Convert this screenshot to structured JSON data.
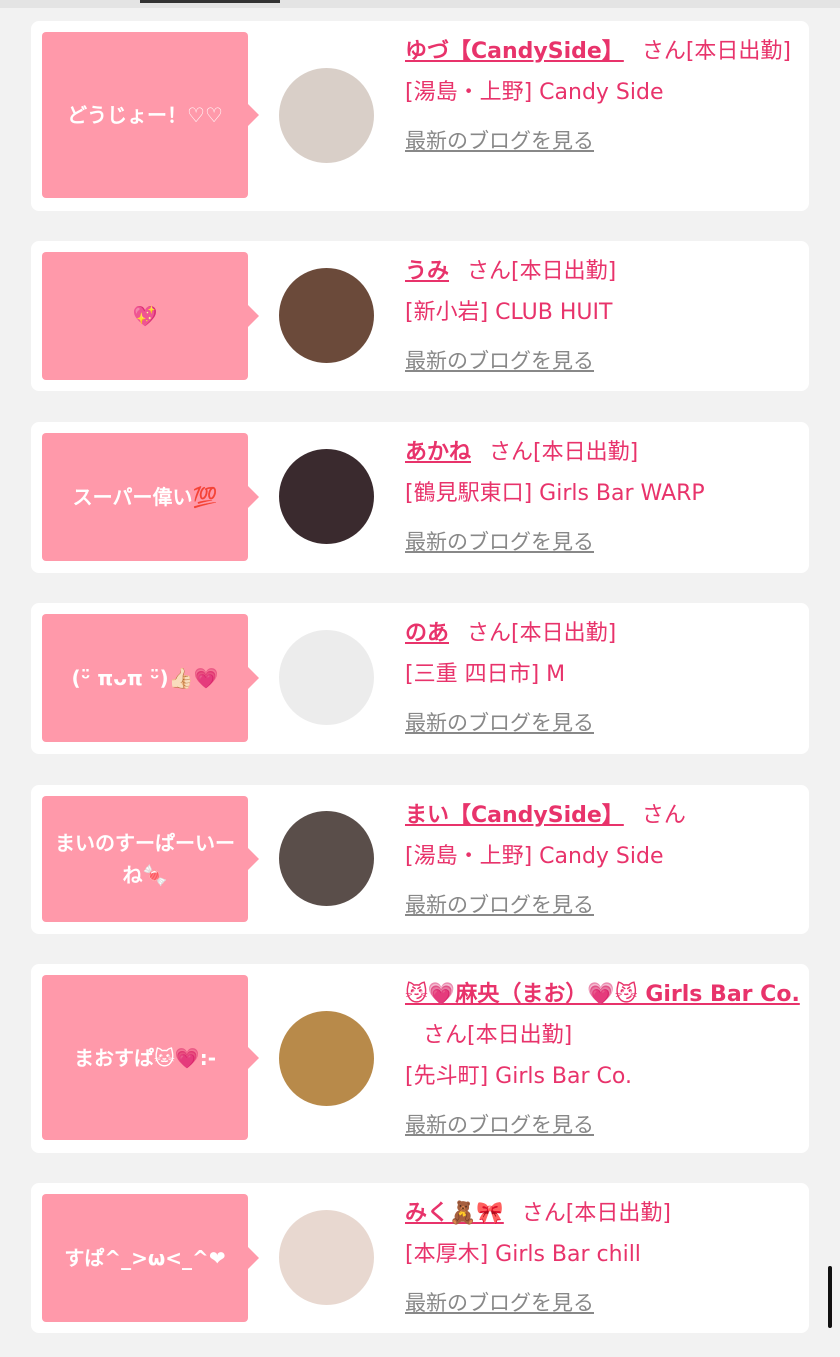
{
  "cards": [
    {
      "bubble": "どうじょー！♡♡",
      "name": "ゆづ【CandySide】",
      "suffix": "さん[本日出勤]",
      "shop": "[湯島・上野] Candy Side",
      "blog": "最新のブログを見る",
      "avatar_color": "#d9cfc8"
    },
    {
      "bubble": "💖",
      "name": "うみ",
      "suffix": "さん[本日出勤]",
      "shop": "[新小岩] CLUB HUIT",
      "blog": "最新のブログを見る",
      "avatar_color": "#6b4a3a"
    },
    {
      "bubble": "スーパー偉い💯",
      "name": "あかね",
      "suffix": "さん[本日出勤]",
      "shop": "[鶴見駅東口] Girls Bar WARP",
      "blog": "最新のブログを見る",
      "avatar_color": "#3a2a2e"
    },
    {
      "bubble": "(ᵕ̈ πᴗπ ᵕ̈)👍🏻💗",
      "name": "のあ",
      "suffix": "さん[本日出勤]",
      "shop": "[三重 四日市] M",
      "blog": "最新のブログを見る",
      "avatar_color": "#ececec"
    },
    {
      "bubble": "まいのすーぱーいーね🍬",
      "name": "まい【CandySide】",
      "suffix": "さん",
      "shop": "[湯島・上野] Candy Side",
      "blog": "最新のブログを見る",
      "avatar_color": "#5a4e4a"
    },
    {
      "bubble": "まおすぱ🐱💗:-",
      "name": "😼💗麻央（まお）💗😼 Girls Bar Co.",
      "suffix": "さん[本日出勤]",
      "shop": "[先斗町] Girls Bar Co.",
      "blog": "最新のブログを見る",
      "avatar_color": "#b88a4a"
    },
    {
      "bubble": "すぱ^_>ω<_^❤",
      "name": "みく🧸🎀",
      "suffix": "さん[本日出勤]",
      "shop": "[本厚木] Girls Bar chill",
      "blog": "最新のブログを見る",
      "avatar_color": "#e8d8d0"
    }
  ]
}
